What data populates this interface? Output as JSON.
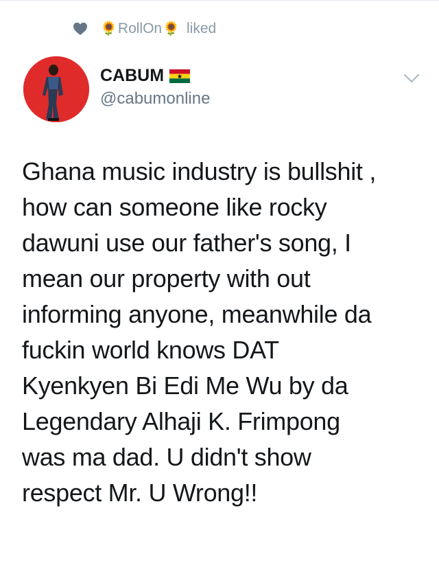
{
  "context": {
    "flower_left": "🌻",
    "liker": "RollOn",
    "flower_right": "🌻",
    "action": "liked"
  },
  "author": {
    "name": "CABUM",
    "flag": "ghana-flag",
    "handle": "@cabumonline"
  },
  "tweet": {
    "text": "Ghana music industry is bullshit ,\nhow can someone like rocky\ndawuni use our father's song, I\nmean our property with out\ninforming anyone, meanwhile da\nfuckin world knows DAT\nKyenkyen Bi Edi Me Wu by da\nLegendary Alhaji K. Frimpong\nwas ma dad. U didn't show\nrespect Mr. U Wrong!!"
  },
  "colors": {
    "muted": "#8899a6",
    "handle": "#657786",
    "text": "#14171a",
    "avatar_bg": "#e02b2b"
  }
}
